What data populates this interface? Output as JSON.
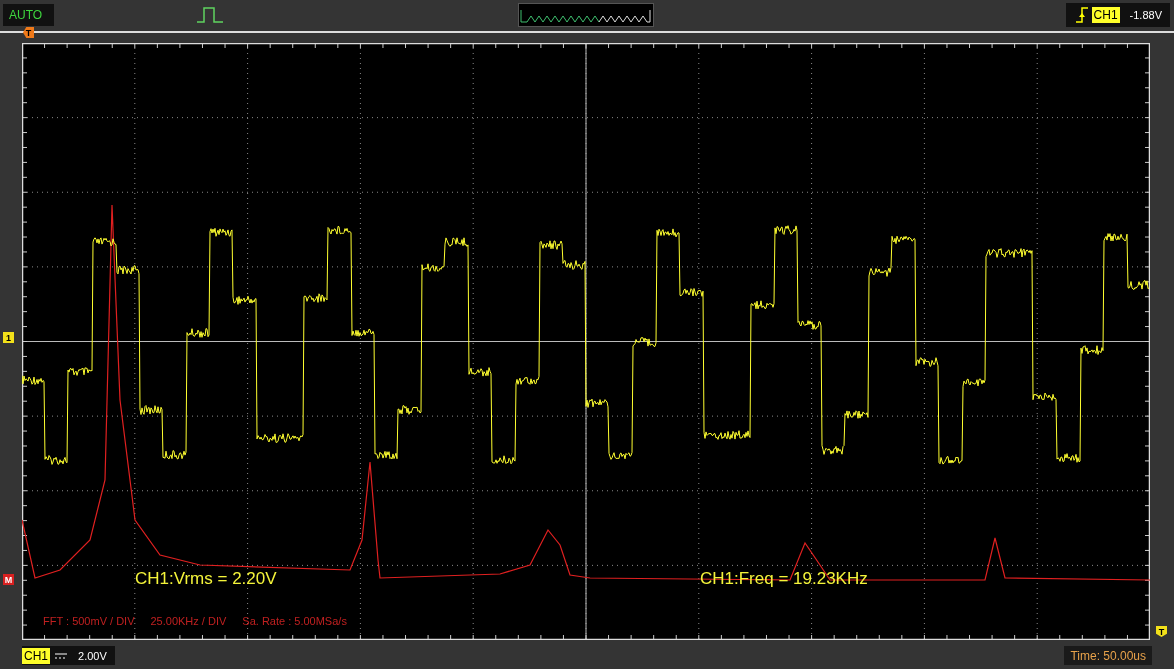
{
  "top_bar": {
    "mode": "AUTO",
    "trigger": {
      "channel": "CH1",
      "voltage": "-1.88V"
    }
  },
  "markers": {
    "trigger_position": "T",
    "channel_1": "1",
    "math": "M",
    "trigger_level": "T"
  },
  "measurements": [
    "CH1:Vrms = 2.20V",
    "CH1:Freq = 19.23KHz"
  ],
  "fft_info": [
    "FFT : 500mV / DIV",
    "25.00KHz / DIV",
    "Sa. Rate : 5.00MSa/s"
  ],
  "bottom_bar": {
    "channel": "CH1",
    "scale": "2.00V",
    "time": "Time: 50.00us"
  }
}
